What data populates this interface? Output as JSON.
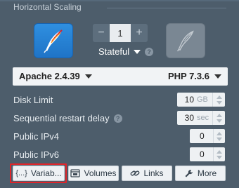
{
  "section": {
    "title": "Horizontal Scaling"
  },
  "scaling": {
    "count": "1",
    "decrement_label": "−",
    "increment_label": "+",
    "mode": "Stateful",
    "help": "?"
  },
  "stack": {
    "server": "Apache 2.4.39",
    "engine": "PHP 7.3.6"
  },
  "settings": {
    "disk_limit": {
      "label": "Disk Limit",
      "value": "10",
      "unit": "GB"
    },
    "restart_delay": {
      "label": "Sequential restart delay",
      "value": "30",
      "unit": "sec",
      "help": "?"
    },
    "public_ipv4": {
      "label": "Public IPv4",
      "value": "0"
    },
    "public_ipv6": {
      "label": "Public IPv6",
      "value": "0"
    }
  },
  "toolbar": {
    "variables": {
      "label": "Variab...",
      "icon": "{...}"
    },
    "volumes": {
      "label": "Volumes"
    },
    "links": {
      "label": "Links"
    },
    "more": {
      "label": "More"
    }
  },
  "colors": {
    "background": "#4d5d6b",
    "accent": "#1f74c7",
    "highlight": "#e0262b"
  }
}
